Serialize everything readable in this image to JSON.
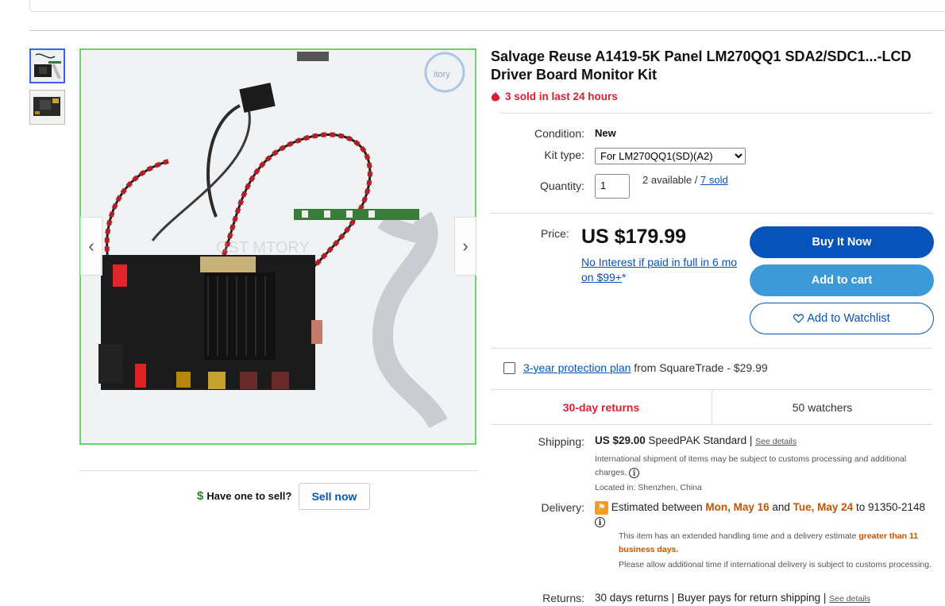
{
  "listing": {
    "title": "Salvage Reuse A1419-5K Panel LM270QQ1 SDA2/SDC1...-LCD Driver Board Monitor Kit",
    "sold_recent": "3 sold in last 24 hours"
  },
  "details": {
    "condition_label": "Condition:",
    "condition_value": "New",
    "kit_type_label": "Kit type:",
    "kit_type_value": "For LM270QQ1(SD)(A2)",
    "quantity_label": "Quantity:",
    "quantity_value": "1",
    "available_text": "2 available / ",
    "sold_link": "7 sold"
  },
  "pricing": {
    "price_label": "Price:",
    "price": "US $179.99",
    "financing_link": "No Interest if paid in full in 6 mo on $99+",
    "financing_suffix": "*"
  },
  "actions": {
    "buy_now": "Buy It Now",
    "add_to_cart": "Add to cart",
    "watchlist": "Add to Watchlist"
  },
  "protection": {
    "plan_link": "3-year protection plan",
    "plan_text": " from SquareTrade - $29.99"
  },
  "stats": {
    "returns_badge": "30-day returns",
    "watchers": "50 watchers"
  },
  "shipping": {
    "label": "Shipping:",
    "cost": "US $29.00",
    "service": " SpeedPAK Standard | ",
    "see_details": "See details",
    "customs_note": "International shipment of items may be subject to customs processing and additional charges.",
    "location": "Located in: Shenzhen, China"
  },
  "delivery": {
    "label": "Delivery:",
    "estimate_prefix": "Estimated between ",
    "date_start": "Mon, May 16",
    "and": " and ",
    "date_end": "Tue, May 24",
    "to_zip": " to 91350-2148",
    "handling_note": "This item has an extended handling time and a delivery estimate ",
    "handling_emphasis": "greater than 11 business days.",
    "intl_note": "Please allow additional time if international delivery is subject to customs processing."
  },
  "returns": {
    "label": "Returns:",
    "text": "30 days returns | Buyer pays for return shipping | ",
    "see_details": "See details"
  },
  "sell": {
    "question": "Have one to sell?",
    "button": "Sell now"
  },
  "colors": {
    "link": "#0654ba",
    "buy_button": "#0654ba",
    "cart_button": "#3d9ad8",
    "urgent_red": "#dd1e31",
    "delivery_orange": "#c45500"
  },
  "icons": [
    "fire-icon",
    "chevron-left-icon",
    "chevron-right-icon",
    "heart-icon",
    "info-icon",
    "delivery-flag-icon",
    "dollar-icon"
  ]
}
